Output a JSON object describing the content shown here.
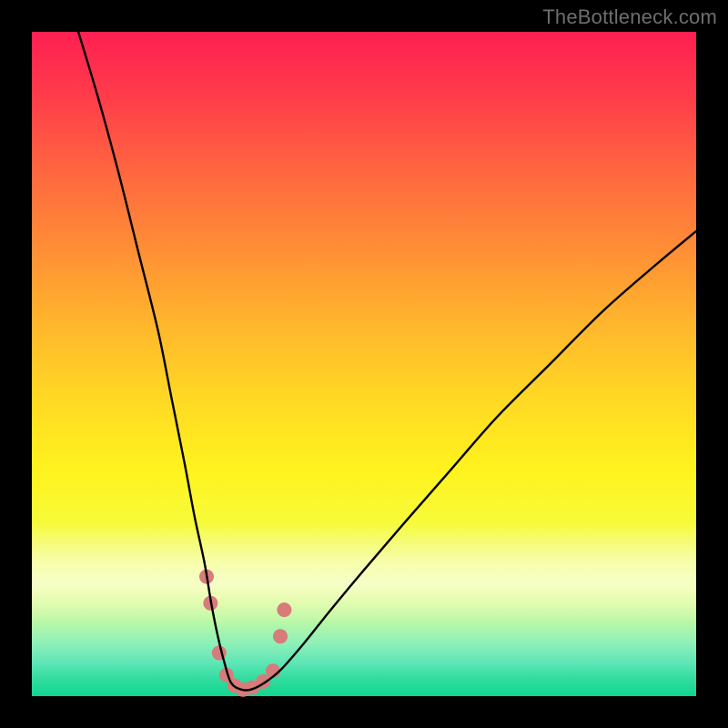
{
  "watermark": "TheBottleneck.com",
  "chart_data": {
    "type": "line",
    "title": "",
    "xlabel": "",
    "ylabel": "",
    "xlim": [
      0,
      100
    ],
    "ylim": [
      0,
      100
    ],
    "grid": false,
    "legend": false,
    "series": [
      {
        "name": "curve",
        "color": "#000000",
        "x": [
          7,
          10,
          13,
          16,
          19,
          21,
          23,
          24.5,
          26,
          27,
          28,
          29,
          30,
          31.5,
          33,
          35,
          37.5,
          41,
          45,
          50,
          56,
          63,
          70,
          78,
          86,
          94,
          100
        ],
        "y": [
          100,
          90,
          79,
          67,
          55,
          45,
          35,
          27,
          20,
          14,
          9,
          5,
          2,
          1,
          1,
          2,
          4,
          8,
          13,
          19,
          26,
          34,
          42,
          50,
          58,
          65,
          70
        ]
      }
    ],
    "markers": [
      {
        "x": 26.3,
        "y": 18.0,
        "r": 8,
        "color": "#d77b7b"
      },
      {
        "x": 26.9,
        "y": 14.0,
        "r": 8,
        "color": "#d77b7b"
      },
      {
        "x": 28.2,
        "y": 6.5,
        "r": 8,
        "color": "#d77b7b"
      },
      {
        "x": 29.3,
        "y": 3.2,
        "r": 8,
        "color": "#d77b7b"
      },
      {
        "x": 30.5,
        "y": 1.6,
        "r": 8,
        "color": "#d77b7b"
      },
      {
        "x": 31.8,
        "y": 1.0,
        "r": 8,
        "color": "#d77b7b"
      },
      {
        "x": 33.2,
        "y": 1.3,
        "r": 8,
        "color": "#d77b7b"
      },
      {
        "x": 34.8,
        "y": 2.2,
        "r": 8,
        "color": "#d77b7b"
      },
      {
        "x": 36.3,
        "y": 3.8,
        "r": 8,
        "color": "#d77b7b"
      },
      {
        "x": 37.4,
        "y": 9.0,
        "r": 8,
        "color": "#d77b7b"
      },
      {
        "x": 38.0,
        "y": 13.0,
        "r": 8,
        "color": "#d77b7b"
      }
    ],
    "gradient_stops": [
      {
        "pos": 0.0,
        "color": "#ff1f52"
      },
      {
        "pos": 0.33,
        "color": "#ff8f35"
      },
      {
        "pos": 0.66,
        "color": "#fff31e"
      },
      {
        "pos": 1.0,
        "color": "#11d68e"
      }
    ]
  }
}
